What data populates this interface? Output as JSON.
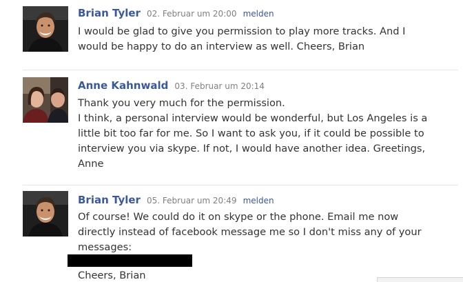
{
  "messages": [
    {
      "author": "Brian Tyler",
      "time": "02. Februar um 20:00",
      "report": "melden",
      "lines": [
        "I would be glad to give you permission to play more tracks. And I",
        "would be happy to do an interview as well. Cheers, Brian"
      ]
    },
    {
      "author": "Anne Kahnwald",
      "time": "03. Februar um 20:14",
      "lines": [
        "Thank you very much for the permission.",
        "I think, a personal interview would be wonderful, but Los Angeles is a",
        "little bit too far for me. So I want to ask you, if it could be possible to",
        "interview you via skype. If not, I would have another idea. Greetings,",
        "Anne"
      ]
    },
    {
      "author": "Brian Tyler",
      "time": "05. Februar um 20:49",
      "report": "melden",
      "lines": [
        "Of course! We could do it on skype or the phone. Email me now",
        "directly instead of facebook message me so I don't miss any of your",
        "messages:"
      ],
      "signoff": "Cheers, Brian"
    }
  ],
  "colors": {
    "author_link": "#3b5998",
    "timestamp": "#808080",
    "body_text": "#333333",
    "redaction": "#000000"
  }
}
